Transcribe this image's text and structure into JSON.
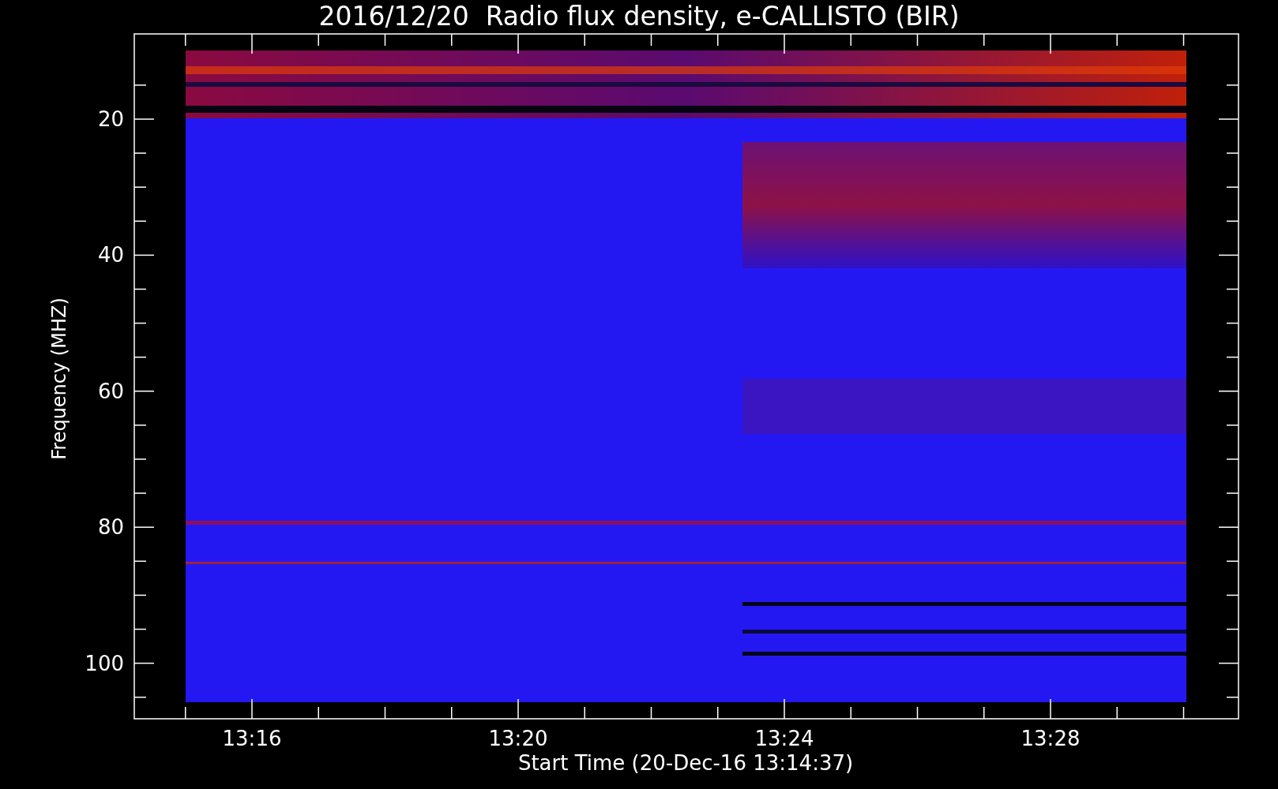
{
  "title": "2016/12/20  Radio flux density, e-CALLISTO (BIR)",
  "y_axis": {
    "label": "Frequency (MHZ)",
    "ticks": [
      "20",
      "40",
      "60",
      "80",
      "100"
    ]
  },
  "x_axis": {
    "label": "Start Time (20-Dec-16 13:14:37)",
    "ticks": [
      "13:16",
      "13:20",
      "13:24",
      "13:28"
    ]
  }
}
